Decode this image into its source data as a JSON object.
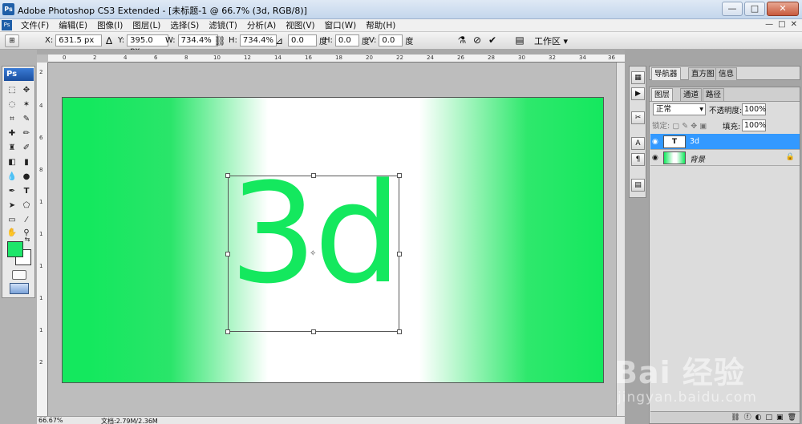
{
  "window": {
    "app_icon": "Ps",
    "title": "Adobe Photoshop CS3 Extended - [未标题-1 @ 66.7% (3d, RGB/8)]",
    "buttons": [
      "—",
      "□",
      "✕"
    ]
  },
  "menu": {
    "items": [
      "文件(F)",
      "编辑(E)",
      "图像(I)",
      "图层(L)",
      "选择(S)",
      "滤镜(T)",
      "分析(A)",
      "视图(V)",
      "窗口(W)",
      "帮助(H)"
    ],
    "mdi_buttons": [
      "—",
      "□",
      "✕"
    ]
  },
  "options": {
    "x_label": "X:",
    "x_value": "631.5 px",
    "y_label": "Y:",
    "y_value": "395.0 px",
    "w_label": "W:",
    "w_value": "734.4%",
    "h_label": "H:",
    "h_value": "734.4%",
    "rot_value": "0.0",
    "deg1": "度",
    "hskew_label": "H:",
    "hskew_value": "0.0",
    "deg2": "度",
    "vskew_label": "V:",
    "vskew_value": "0.0",
    "deg3": "度",
    "workspace": "工作区 ▾"
  },
  "toolbox": {
    "badge": "Ps"
  },
  "rulers": {
    "top_ticks": [
      "0",
      "2",
      "4",
      "6",
      "8",
      "10",
      "12",
      "14",
      "16",
      "18",
      "20",
      "22",
      "24",
      "26",
      "28",
      "30",
      "32",
      "34",
      "36"
    ],
    "left_ticks": [
      "2",
      "4",
      "6",
      "8",
      "1",
      "1",
      "1",
      "1",
      "1",
      "2"
    ]
  },
  "canvas": {
    "text": "3d"
  },
  "status": {
    "zoom": "66.67%",
    "doc": "文档:2.79M/2.36M"
  },
  "panels": {
    "top_tabs": [
      "导航器",
      "直方图",
      "信息"
    ],
    "layer_tabs": [
      "图层",
      "通道",
      "路径"
    ],
    "blend_mode": "正常",
    "opacity_label": "不透明度:",
    "opacity_value": "100%",
    "lock_label": "锁定:",
    "fill_label": "填充:",
    "fill_value": "100%",
    "layers": [
      {
        "name": "3d",
        "thumb": "T"
      },
      {
        "name": "背景",
        "thumb": ""
      }
    ],
    "footer_icons": [
      "ⓕ",
      "◐",
      "□",
      "▣",
      "🗑"
    ]
  },
  "watermark": {
    "main": "Bai 经验",
    "sub": "jingyan.baidu.com"
  },
  "colors": {
    "foreground": "#1ee66a",
    "background": "#ffffff",
    "canvas_green": "#14e85e",
    "selected_layer": "#3399ff"
  }
}
